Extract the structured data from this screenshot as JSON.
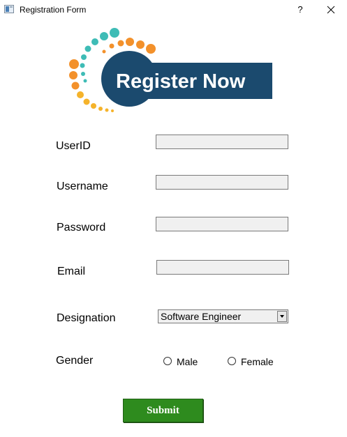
{
  "window": {
    "title": "Registration Form",
    "help_label": "?"
  },
  "logo": {
    "text": "Register Now"
  },
  "form": {
    "userid_label": "UserID",
    "username_label": "Username",
    "password_label": "Password",
    "email_label": "Email",
    "designation_label": "Designation",
    "gender_label": "Gender",
    "userid_value": "",
    "username_value": "",
    "password_value": "",
    "email_value": "",
    "designation_value": "Software Engineer",
    "gender_options": [
      "Male",
      "Female"
    ],
    "submit_label": "Submit"
  },
  "colors": {
    "submit_bg": "#2e8b1e",
    "logo_navy": "#1b4a6e",
    "logo_teal": "#3ebcb6",
    "logo_orange": "#f3912b"
  }
}
